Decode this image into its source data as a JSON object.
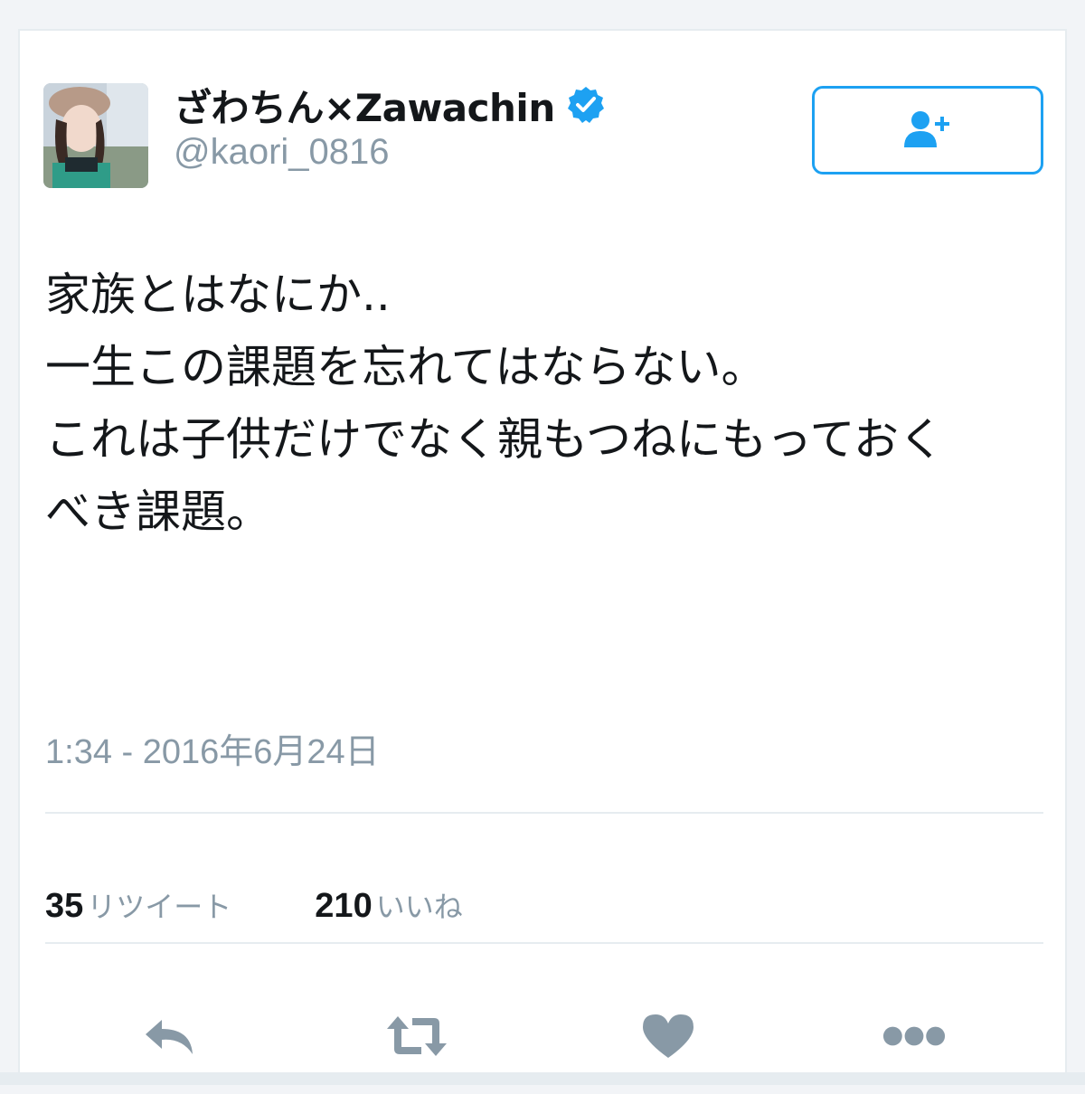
{
  "user": {
    "display_name": "ざわちん×Zawachin",
    "handle": "@kaori_0816",
    "verified": true
  },
  "follow_button": {
    "icon": "follow-user-icon"
  },
  "tweet": {
    "lines": [
      "家族とはなにか..",
      "",
      "一生この課題を忘れてはならない。",
      "",
      "これは子供だけでなく親もつねにもっておく",
      "べき課題。"
    ],
    "timestamp": "1:34 - 2016年6月24日"
  },
  "stats": {
    "retweets": {
      "count": "35",
      "label": "リツイート"
    },
    "likes": {
      "count": "210",
      "label": "いいね"
    }
  },
  "actions": {
    "reply_icon": "reply-icon",
    "retweet_icon": "retweet-icon",
    "like_icon": "heart-icon",
    "more_icon": "more-icon"
  },
  "colors": {
    "accent": "#1da1f2",
    "text": "#14171a",
    "muted": "#8899a6",
    "icon_gray": "#8899a6",
    "divider": "#e6ecf0"
  }
}
